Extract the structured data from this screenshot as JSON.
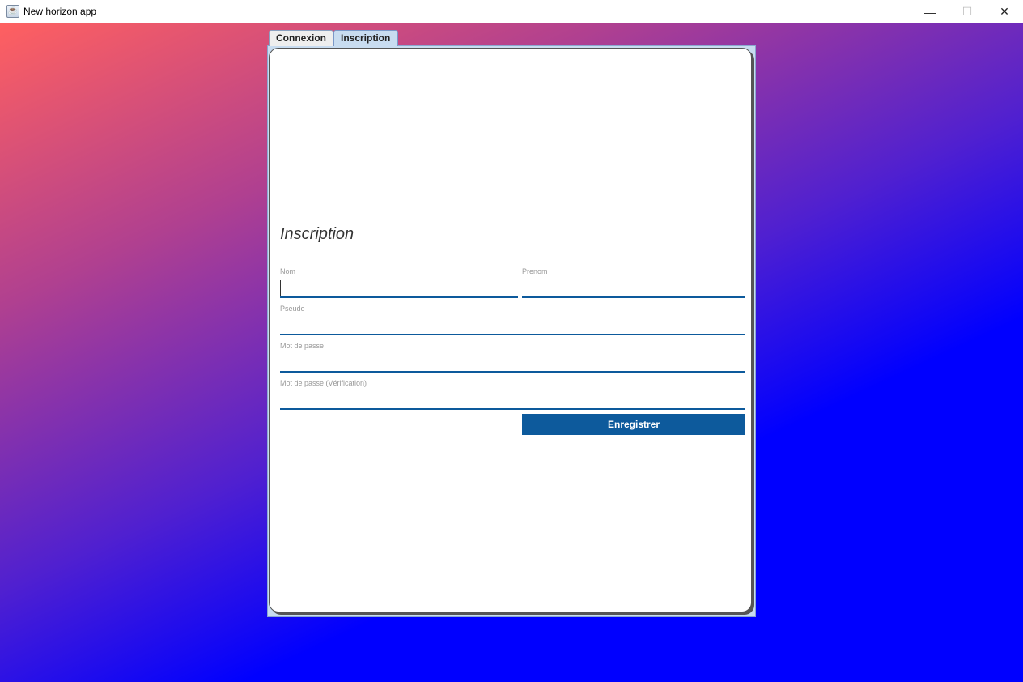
{
  "window": {
    "title": "New horizon app",
    "minimize": "—",
    "maximize": "☐",
    "close": "✕"
  },
  "tabs": [
    {
      "label": "Connexion"
    },
    {
      "label": "Inscription"
    }
  ],
  "form": {
    "heading": "Inscription",
    "fields": [
      {
        "label": "Nom",
        "value": ""
      },
      {
        "label": "Prenom",
        "value": ""
      },
      {
        "label": "Pseudo",
        "value": ""
      },
      {
        "label": "Mot de passe",
        "value": ""
      },
      {
        "label": "Mot de passe (Vérification)",
        "value": ""
      }
    ],
    "submit": "Enregistrer"
  },
  "colors": {
    "accent": "#0d5a9c",
    "gradient_start": "#ff6060",
    "gradient_end": "#0000ff"
  }
}
